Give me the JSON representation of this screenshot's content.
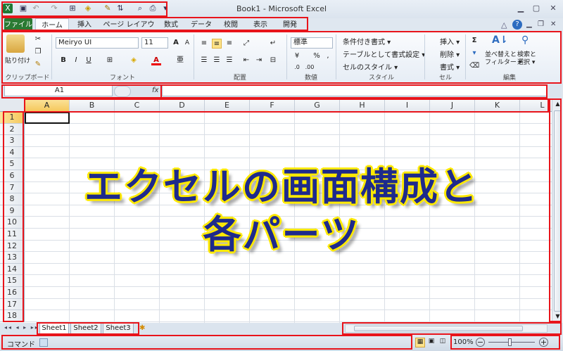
{
  "window": {
    "title": "Book1 - Microsoft Excel"
  },
  "tabs": [
    "ファイル",
    "ホーム",
    "挿入",
    "ページ レイアウト",
    "数式",
    "データ",
    "校閲",
    "表示",
    "開発"
  ],
  "ribbon": {
    "clipboard": {
      "paste": "貼り付け",
      "label": "クリップボード"
    },
    "font": {
      "name": "Meiryo UI",
      "size": "11",
      "label": "フォント",
      "bold": "B",
      "italic": "I",
      "underline": "U"
    },
    "alignment": {
      "label": "配置"
    },
    "number": {
      "format": "標準",
      "label": "数値"
    },
    "styles": {
      "conditional": "条件付き書式 ▾",
      "table": "テーブルとして書式設定 ▾",
      "cell": "セルのスタイル ▾",
      "label": "スタイル"
    },
    "cells": {
      "insert": "挿入 ▾",
      "delete": "削除 ▾",
      "format": "書式 ▾",
      "label": "セル"
    },
    "editing": {
      "sort": "並べ替えと\nフィルター ▾",
      "find": "検索と\n選択 ▾",
      "label": "編集"
    }
  },
  "formula_bar": {
    "name_box": "A1",
    "fx": "fx",
    "value": ""
  },
  "grid": {
    "columns": [
      "A",
      "B",
      "C",
      "D",
      "E",
      "F",
      "G",
      "H",
      "I",
      "J",
      "K",
      "L"
    ],
    "rows": [
      "1",
      "2",
      "3",
      "4",
      "5",
      "6",
      "7",
      "8",
      "9",
      "10",
      "11",
      "12",
      "13",
      "14",
      "15",
      "16",
      "17",
      "18"
    ],
    "overlay_line1": "エクセルの画面構成と",
    "overlay_line2": "各パーツ"
  },
  "sheets": [
    "Sheet1",
    "Sheet2",
    "Sheet3"
  ],
  "status": {
    "mode": "コマンド",
    "zoom": "100%"
  },
  "colors": {
    "file_tab": "#2a7a33",
    "highlight": "#e8141b",
    "overlay_text": "#1e2a8c",
    "overlay_outline": "#ffe900"
  }
}
